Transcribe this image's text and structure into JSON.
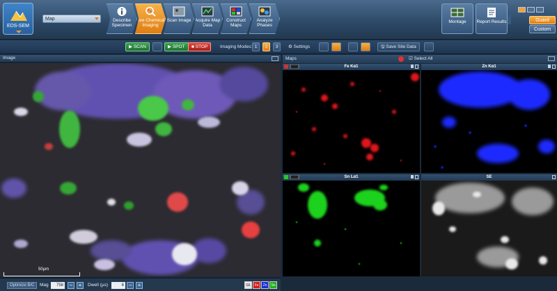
{
  "ribbon": {
    "app_label": "EDS-SEM",
    "mode_select": "Map",
    "workflow": [
      {
        "label": "Describe Specimen"
      },
      {
        "label": "Live Chemical Imaging",
        "active": true
      },
      {
        "label": "Scan Image"
      },
      {
        "label": "Acquire Map Data"
      },
      {
        "label": "Construct Maps"
      },
      {
        "label": "Analyze Phases"
      }
    ],
    "montage": "Montage",
    "report": "Report Results",
    "guard": "Guard",
    "custom": "Custom"
  },
  "toolbar": {
    "scan": "SCAN",
    "spot": "SPOT",
    "stop": "STOP",
    "imaging_modes_label": "Imaging Modes:",
    "imaging_modes": [
      "1",
      "2",
      "3"
    ],
    "active_mode": "2",
    "settings": "Settings",
    "save_site": "Save Site Data"
  },
  "image_pane": {
    "title": "Image",
    "scale": "50µm",
    "optimize": "Optimize B/C",
    "mag_label": "Mag",
    "mag_value": "758",
    "dwell_label": "Dwell (µs)",
    "dwell_value": "6",
    "detectors": [
      "SE",
      "Fe",
      "Zn",
      "Sn"
    ]
  },
  "maps_pane": {
    "title": "Maps",
    "select_all": "Select All",
    "maps": [
      {
        "label": "Fe Kα1",
        "color": "#e0141e"
      },
      {
        "label": "Zn Kα1",
        "color": "#1a2cff"
      },
      {
        "label": "Sn Lα1",
        "color": "#1fd21f"
      },
      {
        "label": "SE",
        "color": "#d8d8d8"
      }
    ]
  }
}
